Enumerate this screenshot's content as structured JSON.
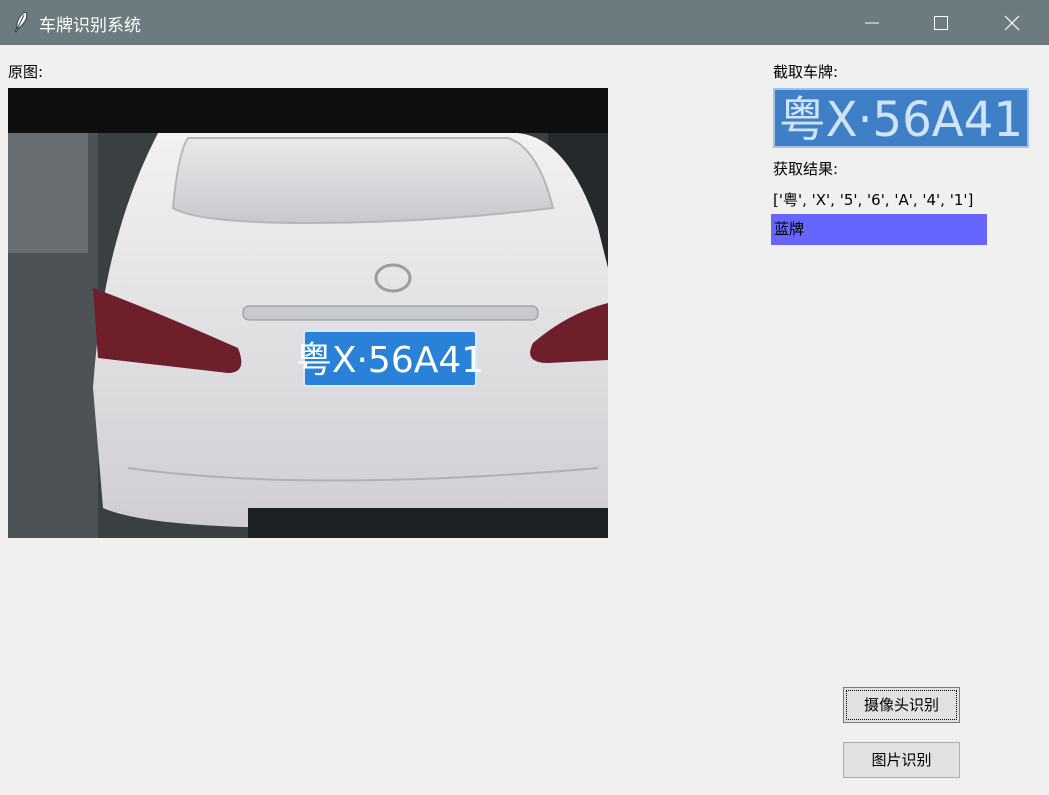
{
  "window": {
    "title": "车牌识别系统",
    "controls": {
      "minimize": "minimize-icon",
      "maximize": "maximize-icon",
      "close": "close-icon"
    }
  },
  "labels": {
    "original": "原图:",
    "cropped_plate": "截取车牌:",
    "result": "获取结果:"
  },
  "result": {
    "characters": "['粤', 'X', '5', '6', 'A', '4', '1']",
    "plate_color_label": "蓝牌",
    "plate_color_hex": "#6666ff"
  },
  "plate": {
    "text": "粤X·56A41",
    "color": "#2a82d8"
  },
  "buttons": {
    "camera": "摄像头识别",
    "image": "图片识别"
  }
}
